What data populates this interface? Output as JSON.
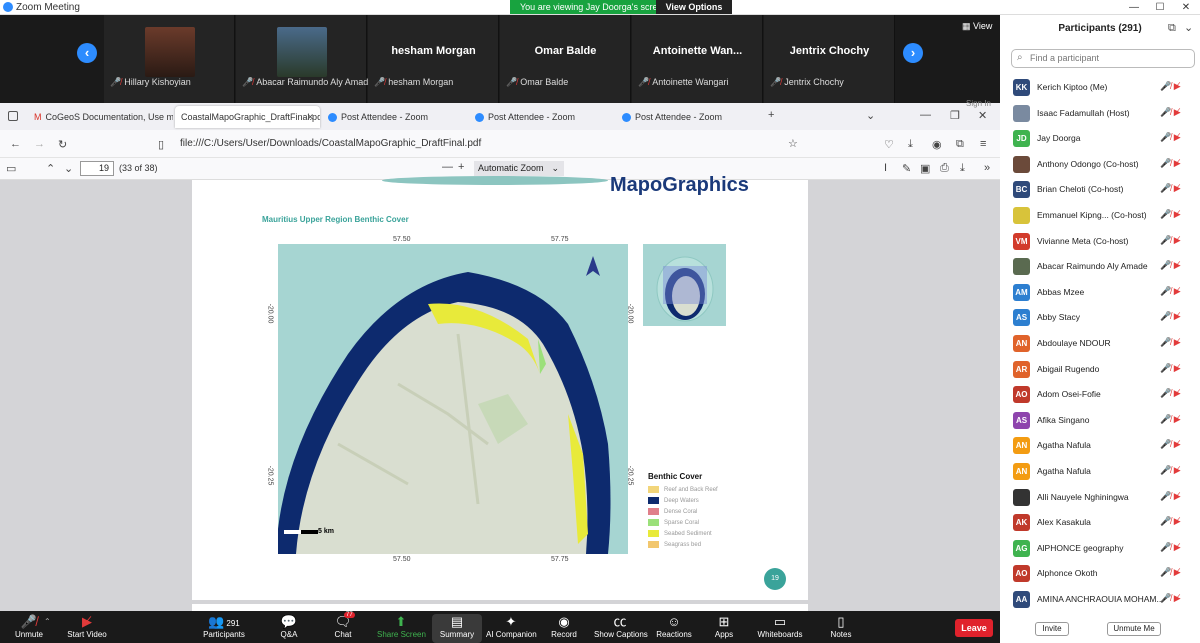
{
  "window": {
    "title": "Zoom Meeting",
    "minimize": "—",
    "maximize": "☐",
    "close": "✕"
  },
  "share_banner": {
    "text": "You are viewing Jay Doorga's screen",
    "view_options": "View Options"
  },
  "strip": {
    "view_label": "View",
    "tiles": [
      {
        "display": "",
        "label": "Hillary Kishoyian"
      },
      {
        "display": "",
        "label": "Abacar Raimundo Aly Amade"
      },
      {
        "display": "hesham Morgan",
        "label": "hesham Morgan"
      },
      {
        "display": "Omar Balde",
        "label": "Omar Balde"
      },
      {
        "display": "Antoinette  Wan...",
        "label": "Antoinette Wangari"
      },
      {
        "display": "Jentrix Chochy",
        "label": "Jentrix Chochy"
      }
    ]
  },
  "browser": {
    "tabs": [
      "CoGeoS Documentation, Use m",
      "CoastalMapoGraphic_DraftFinal.pdf",
      "Post Attendee - Zoom",
      "Post Attendee - Zoom",
      "Post Attendee - Zoom"
    ],
    "url": "file:///C:/Users/User/Downloads/CoastalMapoGraphic_DraftFinal.pdf",
    "sign_in": "Sign In",
    "pdf": {
      "page": "19",
      "page_count": "(33 of 38)",
      "zoom": "Automatic Zoom"
    }
  },
  "document": {
    "brand": "MapoGraphics",
    "map_title": "Mauritius Upper Region Benthic Cover",
    "coords": {
      "top1": "57.50",
      "top2": "57.75",
      "bottom1": "57.50",
      "bottom2": "57.75",
      "left1": "-20.00",
      "left2": "-20.25",
      "right1": "-20.00",
      "right2": "-20.25"
    },
    "scale": "5 km",
    "legend": {
      "title": "Benthic Cover",
      "items": [
        {
          "label": "Reef and Back Reef",
          "color": "#f2d57a"
        },
        {
          "label": "Deep Waters",
          "color": "#0d2a6e"
        },
        {
          "label": "Dense Coral",
          "color": "#e07f8a"
        },
        {
          "label": "Sparse Coral",
          "color": "#9be07a"
        },
        {
          "label": "Seabed Sediment",
          "color": "#e8ea3a"
        },
        {
          "label": "Seagrass bed",
          "color": "#f2c76e"
        }
      ]
    },
    "page_badge": "19"
  },
  "participants": {
    "title": "Participants (291)",
    "search_placeholder": "Find a participant",
    "list": [
      {
        "initials": "KK",
        "name": "Kerich Kiptoo (Me)",
        "color": "#2f4a7a"
      },
      {
        "initials": "",
        "name": "Isaac Fadamullah (Host)",
        "color": "#7a8aa0"
      },
      {
        "initials": "JD",
        "name": "Jay Doorga",
        "color": "#3fb34f"
      },
      {
        "initials": "",
        "name": "Anthony Odongo (Co-host)",
        "color": "#6b4a3a"
      },
      {
        "initials": "BC",
        "name": "Brian Cheloti (Co-host)",
        "color": "#2f4a7a"
      },
      {
        "initials": "",
        "name": "Emmanuel Kipng... (Co-host)",
        "color": "#d8c33a"
      },
      {
        "initials": "VM",
        "name": "Vivianne Meta (Co-host)",
        "color": "#d23b2b"
      },
      {
        "initials": "",
        "name": "Abacar Raimundo Aly Amade",
        "color": "#5a6a50"
      },
      {
        "initials": "AM",
        "name": "Abbas Mzee",
        "color": "#2d7fd0"
      },
      {
        "initials": "AS",
        "name": "Abby Stacy",
        "color": "#2d7fd0"
      },
      {
        "initials": "AN",
        "name": "Abdoulaye NDOUR",
        "color": "#e0632b"
      },
      {
        "initials": "AR",
        "name": "Abigail Rugendo",
        "color": "#e0632b"
      },
      {
        "initials": "AO",
        "name": "Adom Osei-Fofie",
        "color": "#c0392b"
      },
      {
        "initials": "AS",
        "name": "Afika Singano",
        "color": "#8e44ad"
      },
      {
        "initials": "AN",
        "name": "Agatha Nafula",
        "color": "#f39c12"
      },
      {
        "initials": "AN",
        "name": "Agatha Nafula",
        "color": "#f39c12"
      },
      {
        "initials": "",
        "name": "Alli Nauyele Nghiningwa",
        "color": "#333333"
      },
      {
        "initials": "AK",
        "name": "Alex Kasakula",
        "color": "#c0392b"
      },
      {
        "initials": "AG",
        "name": "AlPHONCE geography",
        "color": "#3fb34f"
      },
      {
        "initials": "AO",
        "name": "Alphonce Okoth",
        "color": "#c0392b"
      },
      {
        "initials": "AA",
        "name": "AMINA ANCHRAOUIA MOHAM...",
        "color": "#2f4a7a"
      }
    ],
    "invite": "Invite",
    "unmute_me": "Unmute Me"
  },
  "toolbar": {
    "unmute": "Unmute",
    "start_video": "Start Video",
    "participants": "Participants",
    "participants_count": "291",
    "qa": "Q&A",
    "chat": "Chat",
    "chat_badge": "77",
    "share_screen": "Share Screen",
    "summary": "Summary",
    "ai_companion": "AI Companion",
    "record": "Record",
    "show_captions": "Show Captions",
    "reactions": "Reactions",
    "apps": "Apps",
    "whiteboards": "Whiteboards",
    "notes": "Notes",
    "leave": "Leave"
  }
}
